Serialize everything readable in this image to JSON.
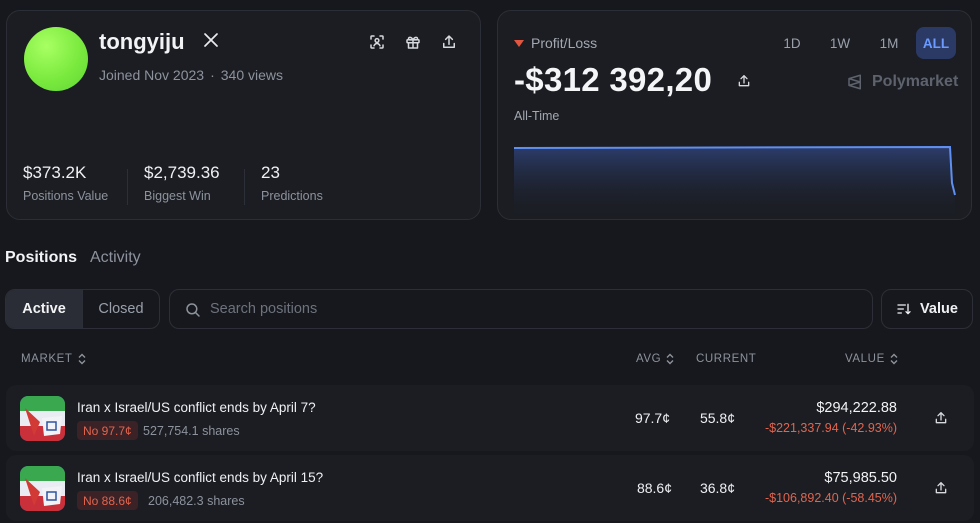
{
  "profile": {
    "username": "tongyiju",
    "joined": "Joined Nov 2023",
    "separator": "·",
    "views": "340 views",
    "stats": [
      {
        "value": "$373.2K",
        "label": "Positions Value"
      },
      {
        "value": "$2,739.36",
        "label": "Biggest Win"
      },
      {
        "value": "23",
        "label": "Predictions"
      }
    ],
    "icons": [
      "x-logo-icon",
      "scan-icon",
      "gift-icon",
      "share-icon"
    ]
  },
  "pnl": {
    "label": "Profit/Loss",
    "value": "-$312 392,20",
    "period_label": "All-Time",
    "brand": "Polymarket",
    "ranges": [
      "1D",
      "1W",
      "1M",
      "ALL"
    ],
    "active_range": "ALL",
    "accent_color": "#6c9bff",
    "loss_color": "#e2553f"
  },
  "tabs": {
    "positions": "Positions",
    "activity": "Activity"
  },
  "filters": {
    "active": "Active",
    "closed": "Closed",
    "search_placeholder": "Search positions",
    "sort_label": "Value"
  },
  "table": {
    "headers": {
      "market": "MARKET",
      "avg": "AVG",
      "current": "CURRENT",
      "value": "VALUE"
    },
    "rows": [
      {
        "title": "Iran x Israel/US conflict ends by April 7?",
        "outcome": "No 97.7¢",
        "shares": "527,754.1 shares",
        "avg": "97.7¢",
        "current": "55.8¢",
        "value": "$294,222.88",
        "pnl": "-$221,337.94 (-42.93%)"
      },
      {
        "title": "Iran x Israel/US conflict ends by April 15?",
        "outcome": "No 88.6¢",
        "shares": "206,482.3 shares",
        "avg": "88.6¢",
        "current": "36.8¢",
        "value": "$75,985.50",
        "pnl": "-$106,892.40 (-58.45%)"
      }
    ]
  }
}
